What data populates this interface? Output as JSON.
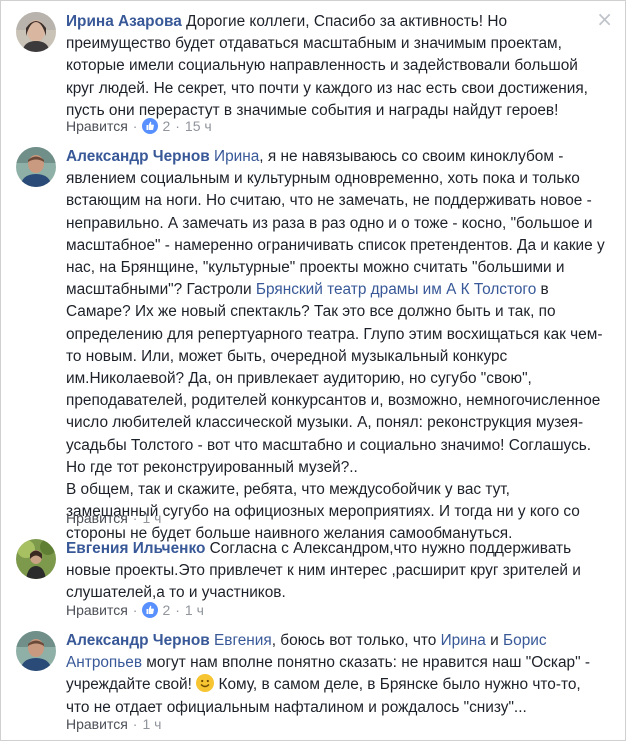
{
  "comments": [
    {
      "author": "Ирина Азарова",
      "text": "Дорогие коллеги, Спасибо за активность! Но преимущество будет отдаваться масштабным и значимым проектам, которые имели социальную направленность и задействовали большой круг людей. Не секрет, что почти у каждого из нас есть свои достижения, пусть они перерастут в значимые события и награды найдут героев!",
      "like_label": "Нравится",
      "like_count": "2",
      "time": "15 ч"
    },
    {
      "author": "Александр Чернов",
      "mention1": "Ирина",
      "text1": ", я не навязываюсь со своим киноклубом - явлением социальным и культурным одновременно, хоть пока и только встающим на ноги. Но считаю, что не замечать, не поддерживать новое - неправильно. А замечать из раза в раз одно и о тоже - косно, \"большое и масштабное\" - намеренно ограничивать список претендентов. Да и какие у нас, на Брянщине, \"культурные\" проекты можно считать \"большими и масштабными\"? Гастроли ",
      "mention2": "Брянский театр драмы им А К Толстого",
      "text2": " в Самаре? Их же новый спектакль? Так это все должно быть и так, по определению для репертуарного театра. Глупо этим восхищаться как чем-то новым. Или, может быть, очередной музыкальный конкурс им.Николаевой? Да, он привлекает аудиторию, но сугубо \"свою\", преподавателей, родителей конкурсантов и, возможно, немногочисленное число любителей классической музыки. А, понял: реконструкция музея-усадьбы Толстого - вот что масштабно и социально значимо! Соглашусь. Но где тот реконструированный музей?..",
      "text3": "В общем, так и скажите, ребята, что междусобойчик у вас тут, замешанный сугубо на официозных мероприятиях. И тогда ни у кого со стороны не будет больше наивного желания самообмануться.",
      "like_label": "Нравится",
      "time": "1 ч"
    },
    {
      "author": "Евгения Ильченко",
      "text": "Согласна с Александром,что нужно поддерживать новые проекты.Это привлечет к ним интерес ,расширит круг зрителей и слушателей,а то и участников.",
      "like_label": "Нравится",
      "like_count": "2",
      "time": "1 ч"
    },
    {
      "author": "Александр Чернов",
      "mention1": "Евгения",
      "text1": ", боюсь вот только, что ",
      "mention2": "Ирина",
      "text2": " и ",
      "mention3": "Борис Антропьев",
      "text3": " могут нам вполне понятно сказать: не нравится наш \"Оскар\" - учреждайте свой! ",
      "text4": " Кому, в самом деле, в Брянске было нужно что-то, что не отдает официальным нафталином и рождалось \"снизу\"...",
      "like_label": "Нравится",
      "time": "1 ч"
    }
  ],
  "close_glyph": "×",
  "separator": "·",
  "colors": {
    "link": "#385898",
    "text": "#1d2129",
    "meta": "#90949c",
    "like_badge": "#5890ff"
  }
}
